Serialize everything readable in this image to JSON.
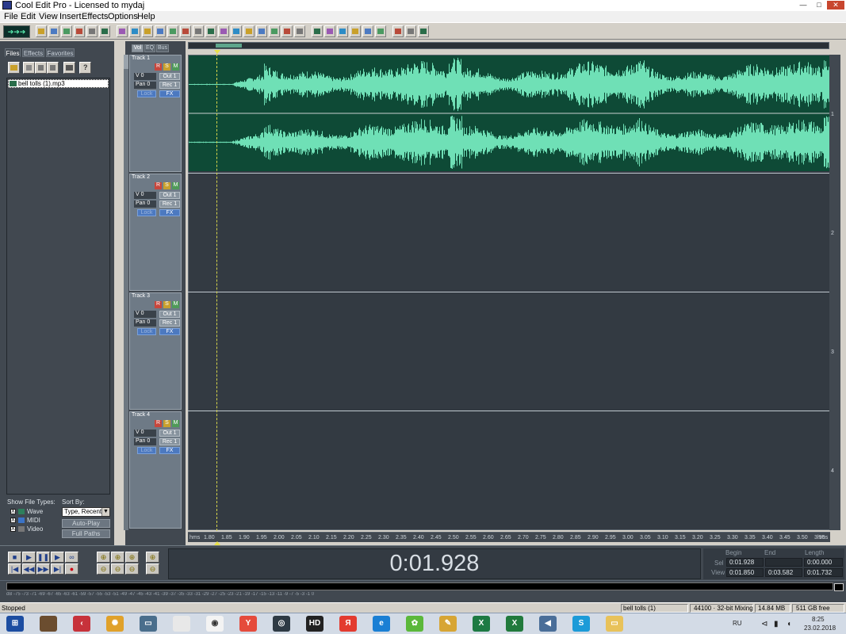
{
  "window": {
    "title": "Cool Edit Pro - Licensed to mydaj",
    "controls": {
      "minimize": "—",
      "maximize": "□",
      "close": "✕"
    }
  },
  "menu": [
    "File",
    "Edit",
    "View",
    "Insert",
    "Effects",
    "Options",
    "Help"
  ],
  "toolbar": {
    "main_button_icon": "waveform-toggle-icon",
    "groups": [
      [
        "new-icon",
        "open-icon",
        "open-append-icon",
        "save-icon",
        "save-all-icon",
        "close-icon"
      ],
      [
        "undo-icon",
        "cue-icon",
        "cut-icon",
        "copy-icon",
        "paste-icon",
        "play-icon",
        "stop-icon",
        "loop-icon",
        "envelope-icon",
        "mix-icon",
        "track-icon",
        "insert-wave-icon",
        "insert-midi-icon",
        "settings-icon",
        "mute-icon"
      ],
      [
        "record-icon",
        "monitor-icon",
        "wave-icon",
        "fx-icon",
        "bpm-icon",
        "device-icon"
      ],
      [
        "cd-icon",
        "zoom-icon",
        "help-icon"
      ]
    ]
  },
  "left_panel": {
    "tabs": [
      "Files",
      "Effects",
      "Favorites"
    ],
    "active_tab": "Files",
    "files": [
      {
        "name": "bell tolls (1).mp3",
        "selected": true
      }
    ],
    "show_file_types_label": "Show File Types:",
    "file_types": [
      {
        "label": "Wave",
        "checked": "X"
      },
      {
        "label": "MIDI",
        "checked": "X"
      },
      {
        "label": "Video",
        "checked": "X"
      }
    ],
    "sort_by_label": "Sort By:",
    "sort_by_value": "Type, Recent",
    "sort_arrow": "▼",
    "auto_play": "Auto-Play",
    "full_paths": "Full Paths"
  },
  "track_header": {
    "tabs": [
      "Vol",
      "EQ",
      "Bus"
    ],
    "active_tab": "Vol"
  },
  "tracks": [
    {
      "name": "Track 1",
      "volume": "V 0",
      "pan": "Pan 0",
      "out": "Out 1",
      "rec": "Rec 1",
      "lock": "Lock",
      "fx": "FX",
      "r": "R",
      "s": "S",
      "m": "M",
      "number": "1"
    },
    {
      "name": "Track 2",
      "volume": "V 0",
      "pan": "Pan 0",
      "out": "Out 1",
      "rec": "Rec 1",
      "lock": "Lock",
      "fx": "FX",
      "r": "R",
      "s": "S",
      "m": "M",
      "number": "2"
    },
    {
      "name": "Track 3",
      "volume": "V 0",
      "pan": "Pan 0",
      "out": "Out 1",
      "rec": "Rec 1",
      "lock": "Lock",
      "fx": "FX",
      "r": "R",
      "s": "S",
      "m": "M",
      "number": "3"
    },
    {
      "name": "Track 4",
      "volume": "V 0",
      "pan": "Pan 0",
      "out": "Out 1",
      "rec": "Rec 1",
      "lock": "Lock",
      "fx": "FX",
      "r": "R",
      "s": "S",
      "m": "M",
      "number": "4"
    }
  ],
  "colors": {
    "waveform": "#6fe0b6",
    "waveform_bg": "#0e4a36",
    "cursor": "#d6d44a",
    "track_area": "#333a42"
  },
  "ruler": {
    "start_label": "hms",
    "end_label": "hms",
    "ticks": [
      "1.80",
      "1.85",
      "1.90",
      "1.95",
      "2.00",
      "2.05",
      "2.10",
      "2.15",
      "2.20",
      "2.25",
      "2.30",
      "2.35",
      "2.40",
      "2.45",
      "2.50",
      "2.55",
      "2.60",
      "2.65",
      "2.70",
      "2.75",
      "2.80",
      "2.85",
      "2.90",
      "2.95",
      "3.00",
      "3.05",
      "3.10",
      "3.15",
      "3.20",
      "3.25",
      "3.30",
      "3.35",
      "3.40",
      "3.45",
      "3.50",
      "3.55"
    ]
  },
  "transport": {
    "buttons_row1": [
      "stop-icon",
      "play-icon",
      "pause-icon",
      "play-to-end-icon",
      "loop-play-icon"
    ],
    "buttons_row2": [
      "go-to-start-icon",
      "rewind-icon",
      "fast-forward-icon",
      "go-to-end-icon",
      "record-icon"
    ],
    "zoom_row1": [
      "zoom-in-horizontal-icon",
      "zoom-out-horizontal-icon",
      "zoom-full-icon",
      "zoom-in-vertical-icon"
    ],
    "zoom_row2": [
      "zoom-left-icon",
      "zoom-right-icon",
      "zoom-selection-icon",
      "zoom-out-vertical-icon"
    ]
  },
  "time_display": "0:01.928",
  "selection": {
    "headers": [
      "Begin",
      "End",
      "Length"
    ],
    "sel_label": "Sel",
    "view_label": "View",
    "sel": {
      "begin": "0:01.928",
      "end": "",
      "length": "0:00.000"
    },
    "view": {
      "begin": "0:01.850",
      "end": "0:03.582",
      "length": "0:01.732"
    }
  },
  "meter_scale": "dB -75 -73 -71 -69 -67 -65 -63 -61 -59 -57 -55 -53 -51 -49 -47 -45 -43 -41 -39 -37 -35 -33 -31 -29 -27 -25 -23 -21 -19 -17 -15 -13 -11 -9 -7 -5 -3 -1 0",
  "status": {
    "state": "Stopped",
    "file": "bell tolls (1)",
    "format": "44100 · 32-bit Mixing",
    "size": "14.84 MB",
    "free": "511 GB free"
  },
  "taskbar": {
    "apps": [
      "start-orb-icon",
      "cool-edit-icon",
      "archive-icon",
      "red-arrow-icon",
      "sun-icon",
      "window-icon",
      "chrome-icon",
      "yandex-icon",
      "media-icon",
      "hd-player-icon",
      "yandex-browser-icon",
      "edge-icon",
      "icq-icon",
      "pen-icon",
      "excel-icon",
      "excel-green-icon",
      "speaker-icon",
      "skype-icon",
      "folder-icon"
    ],
    "lang": "RU",
    "time": "8:25",
    "date": "23.02.2018"
  }
}
